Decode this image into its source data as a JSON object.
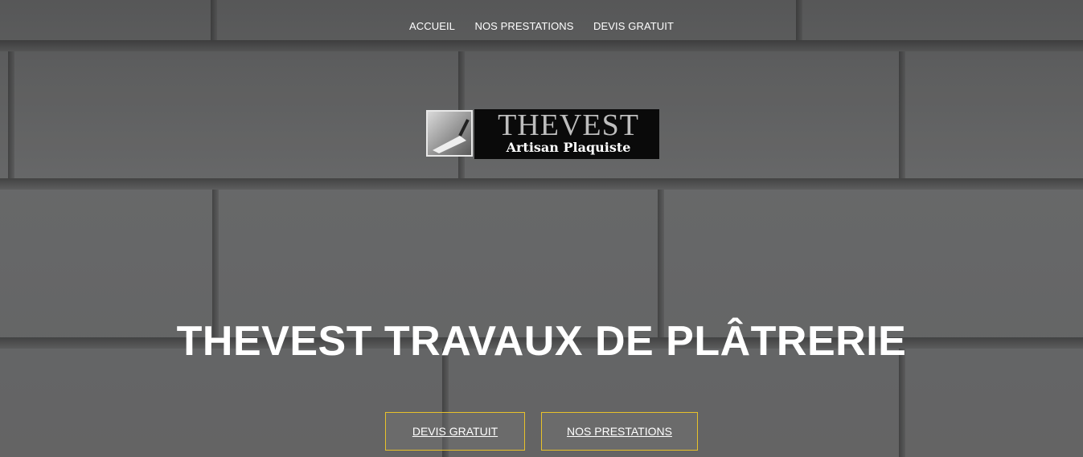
{
  "nav": {
    "items": [
      {
        "label": "ACCUEIL"
      },
      {
        "label": "NOS PRESTATIONS"
      },
      {
        "label": "DEVIS GRATUIT"
      }
    ]
  },
  "logo": {
    "title": "THEVEST",
    "subtitle": "Artisan Plaquiste"
  },
  "hero": {
    "heading": "THEVEST TRAVAUX DE PLÂTRERIE",
    "buttons": [
      {
        "label": "DEVIS GRATUIT"
      },
      {
        "label": "NOS PRESTATIONS"
      }
    ]
  },
  "colors": {
    "button_border": "#e8c22a",
    "text": "#ffffff"
  }
}
